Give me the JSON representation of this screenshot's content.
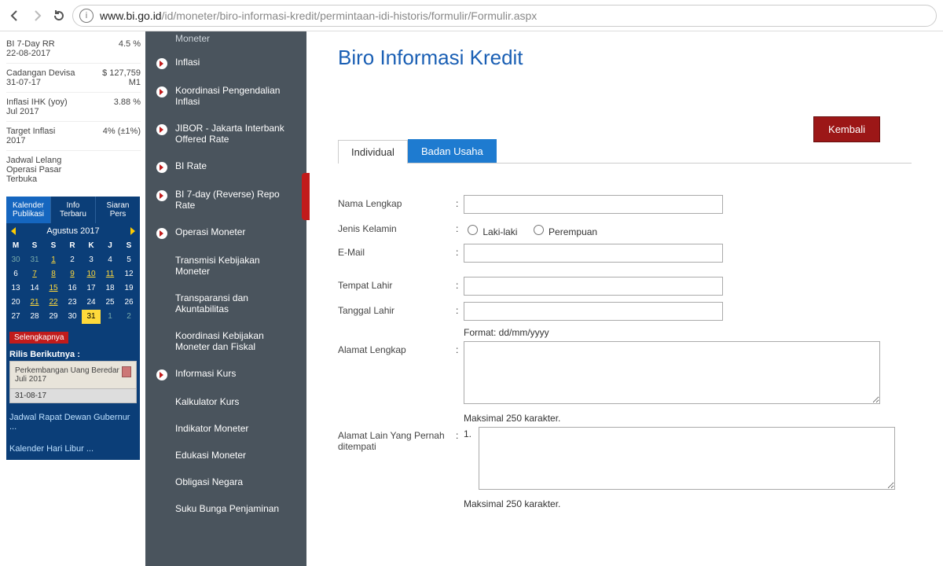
{
  "browser": {
    "url_host": "www.bi.go.id",
    "url_path": "/id/moneter/biro-informasi-kredit/permintaan-idi-historis/formulir/Formulir.aspx"
  },
  "stats": [
    {
      "label": "BI 7-Day RR\n22-08-2017",
      "value": "4.5 %"
    },
    {
      "label": "Cadangan Devisa\n31-07-17",
      "value": "$ 127,759\nM1"
    },
    {
      "label": "Inflasi IHK (yoy)\nJul 2017",
      "value": "3.88 %"
    },
    {
      "label": "Target Inflasi\n2017",
      "value": "4% (±1%)"
    },
    {
      "label": "Jadwal Lelang\nOperasi Pasar\nTerbuka",
      "value": ""
    }
  ],
  "cal": {
    "tabs": [
      "Kalender Publikasi",
      "Info Terbaru",
      "Siaran Pers"
    ],
    "month": "Agustus 2017",
    "dow": [
      "M",
      "S",
      "S",
      "R",
      "K",
      "J",
      "S"
    ],
    "rows": [
      [
        {
          "d": "30",
          "dim": true
        },
        {
          "d": "31",
          "dim": true
        },
        {
          "d": "1",
          "u": true
        },
        {
          "d": "2"
        },
        {
          "d": "3"
        },
        {
          "d": "4"
        },
        {
          "d": "5"
        }
      ],
      [
        {
          "d": "6"
        },
        {
          "d": "7",
          "u": true
        },
        {
          "d": "8",
          "u": true
        },
        {
          "d": "9",
          "u": true
        },
        {
          "d": "10",
          "u": true
        },
        {
          "d": "11",
          "u": true
        },
        {
          "d": "12"
        }
      ],
      [
        {
          "d": "13"
        },
        {
          "d": "14"
        },
        {
          "d": "15",
          "u": true
        },
        {
          "d": "16"
        },
        {
          "d": "17"
        },
        {
          "d": "18"
        },
        {
          "d": "19"
        }
      ],
      [
        {
          "d": "20"
        },
        {
          "d": "21",
          "u": true
        },
        {
          "d": "22",
          "u": true
        },
        {
          "d": "23"
        },
        {
          "d": "24"
        },
        {
          "d": "25"
        },
        {
          "d": "26"
        }
      ],
      [
        {
          "d": "27"
        },
        {
          "d": "28"
        },
        {
          "d": "29"
        },
        {
          "d": "30"
        },
        {
          "d": "31",
          "today": true
        },
        {
          "d": "1",
          "dim": true
        },
        {
          "d": "2",
          "dim": true
        }
      ]
    ],
    "selengkapnya": "Selengkapnya",
    "rilis_title": "Rilis Berikutnya :",
    "rilis_item": "Perkembangan Uang Beredar Juli 2017",
    "rilis_date": "31-08-17",
    "link1": "Jadwal Rapat Dewan Gubernur ...",
    "link2": "Kalender Hari Libur ..."
  },
  "menu": {
    "top_partial": "Moneter",
    "items": [
      {
        "label": "Inflasi",
        "bullet": true
      },
      {
        "label": "Koordinasi Pengendalian Inflasi",
        "bullet": true
      },
      {
        "label": "JIBOR - Jakarta Interbank Offered Rate",
        "bullet": true
      },
      {
        "label": "BI Rate",
        "bullet": true
      },
      {
        "label": "BI 7-day (Reverse) Repo Rate",
        "bullet": true
      },
      {
        "label": "Operasi Moneter",
        "bullet": true
      },
      {
        "label": "Transmisi Kebijakan Moneter",
        "bullet": false
      },
      {
        "label": "Transparansi dan Akuntabilitas",
        "bullet": false
      },
      {
        "label": "Koordinasi Kebijakan Moneter dan Fiskal",
        "bullet": false
      },
      {
        "label": "Informasi Kurs",
        "bullet": true
      },
      {
        "label": "Kalkulator Kurs",
        "bullet": false
      },
      {
        "label": "Indikator Moneter",
        "bullet": false
      },
      {
        "label": "Edukasi Moneter",
        "bullet": false
      },
      {
        "label": "Obligasi Negara",
        "bullet": false
      },
      {
        "label": "Suku Bunga Penjaminan",
        "bullet": false
      }
    ]
  },
  "main": {
    "title": "Biro Informasi Kredit",
    "back": "Kembali",
    "tabs": {
      "active": "Individual",
      "other": "Badan Usaha"
    },
    "form": {
      "nama": "Nama Lengkap",
      "jk": "Jenis Kelamin",
      "jk_m": "Laki-laki",
      "jk_f": "Perempuan",
      "email": "E-Mail",
      "tempat": "Tempat Lahir",
      "tanggal": "Tanggal Lahir",
      "tanggal_hint": "Format: dd/mm/yyyy",
      "alamat": "Alamat Lengkap",
      "max250": "Maksimal 250 karakter.",
      "alamat_lain": "Alamat Lain Yang Pernah ditempati",
      "num1": "1."
    }
  }
}
